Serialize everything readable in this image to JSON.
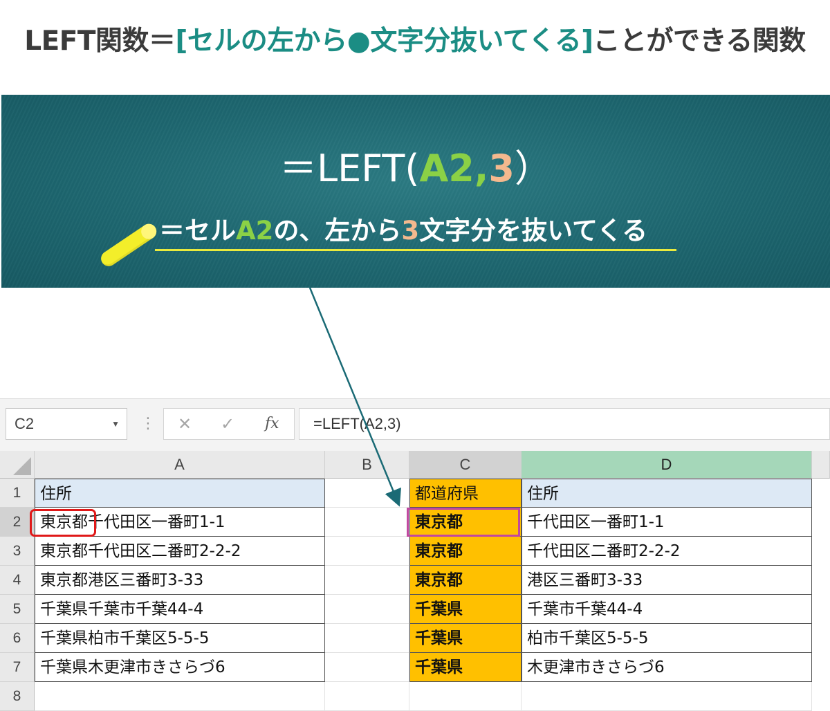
{
  "title": {
    "prefix": "LEFT関数＝",
    "highlight": "[セルの左から●文字分抜いてくる]",
    "suffix": "ことができる関数"
  },
  "board": {
    "formula": {
      "pre": "＝LEFT(",
      "ref": "A2",
      "comma": ",",
      "num": "3",
      "post": "）"
    },
    "explain": {
      "pre": "＝セル",
      "ref": "A2",
      "mid": "の、左から",
      "num": "3",
      "post": "文字分を抜いてくる"
    }
  },
  "excel": {
    "name_box": "C2",
    "icons": {
      "cancel": "✕",
      "enter": "✓",
      "fx": "fx"
    },
    "formula_bar": "=LEFT(A2,3)",
    "columns": [
      "A",
      "B",
      "C",
      "D"
    ],
    "rows": [
      "1",
      "2",
      "3",
      "4",
      "5",
      "6",
      "7",
      "8"
    ],
    "col_a": [
      "住所",
      "東京都千代田区一番町1-1",
      "東京都千代田区二番町2-2-2",
      "東京都港区三番町3-33",
      "千葉県千葉市千葉44-4",
      "千葉県柏市千葉区5-5-5",
      "千葉県木更津市きさらづ6"
    ],
    "col_c": [
      "都道府県",
      "東京都",
      "東京都",
      "東京都",
      "千葉県",
      "千葉県",
      "千葉県"
    ],
    "col_d": [
      "住所",
      "千代田区一番町1-1",
      "千代田区二番町2-2-2",
      "港区三番町3-33",
      "千葉市千葉44-4",
      "柏市千葉区5-5-5",
      "木更津市きさらづ6"
    ]
  },
  "colors": {
    "highlight": "#1b8d84",
    "ref_green": "#8bd146",
    "num_orange": "#f4b98e",
    "cell_orange": "#ffc000",
    "selection": "#c048a0",
    "red_mark": "#e01818"
  }
}
